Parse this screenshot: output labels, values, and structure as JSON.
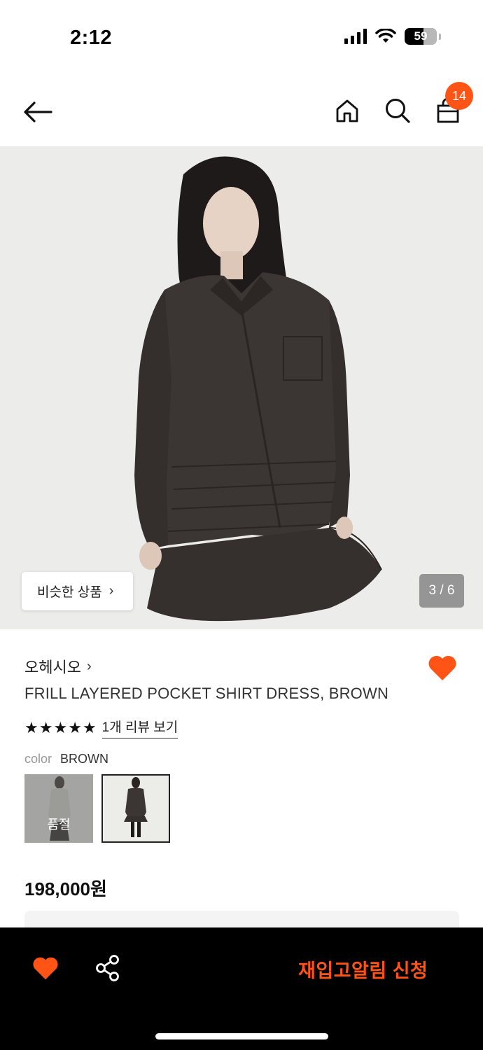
{
  "status_bar": {
    "time": "2:12",
    "battery": "59"
  },
  "header": {
    "cart_count": "14"
  },
  "hero": {
    "similar_label": "비슷한 상품",
    "pager": "3 / 6"
  },
  "product": {
    "brand": "오헤시오",
    "title": "FRILL LAYERED POCKET SHIRT DRESS, BROWN",
    "rating_stars": 5,
    "review_link": "1개 리뷰 보기",
    "color_label": "color",
    "color_value": "BROWN",
    "soldout_label": "품절",
    "price": "198,000원"
  },
  "bottom_bar": {
    "restock_label": "재입고알림 신청"
  },
  "colors": {
    "accent": "#ff5416",
    "dress": "#3b3533",
    "hero_bg": "#ececea"
  },
  "icons": {
    "back": "arrow-left-icon",
    "home": "home-icon",
    "search": "search-icon",
    "cart": "shopping-bag-icon",
    "like": "heart-icon",
    "share": "share-icon"
  }
}
